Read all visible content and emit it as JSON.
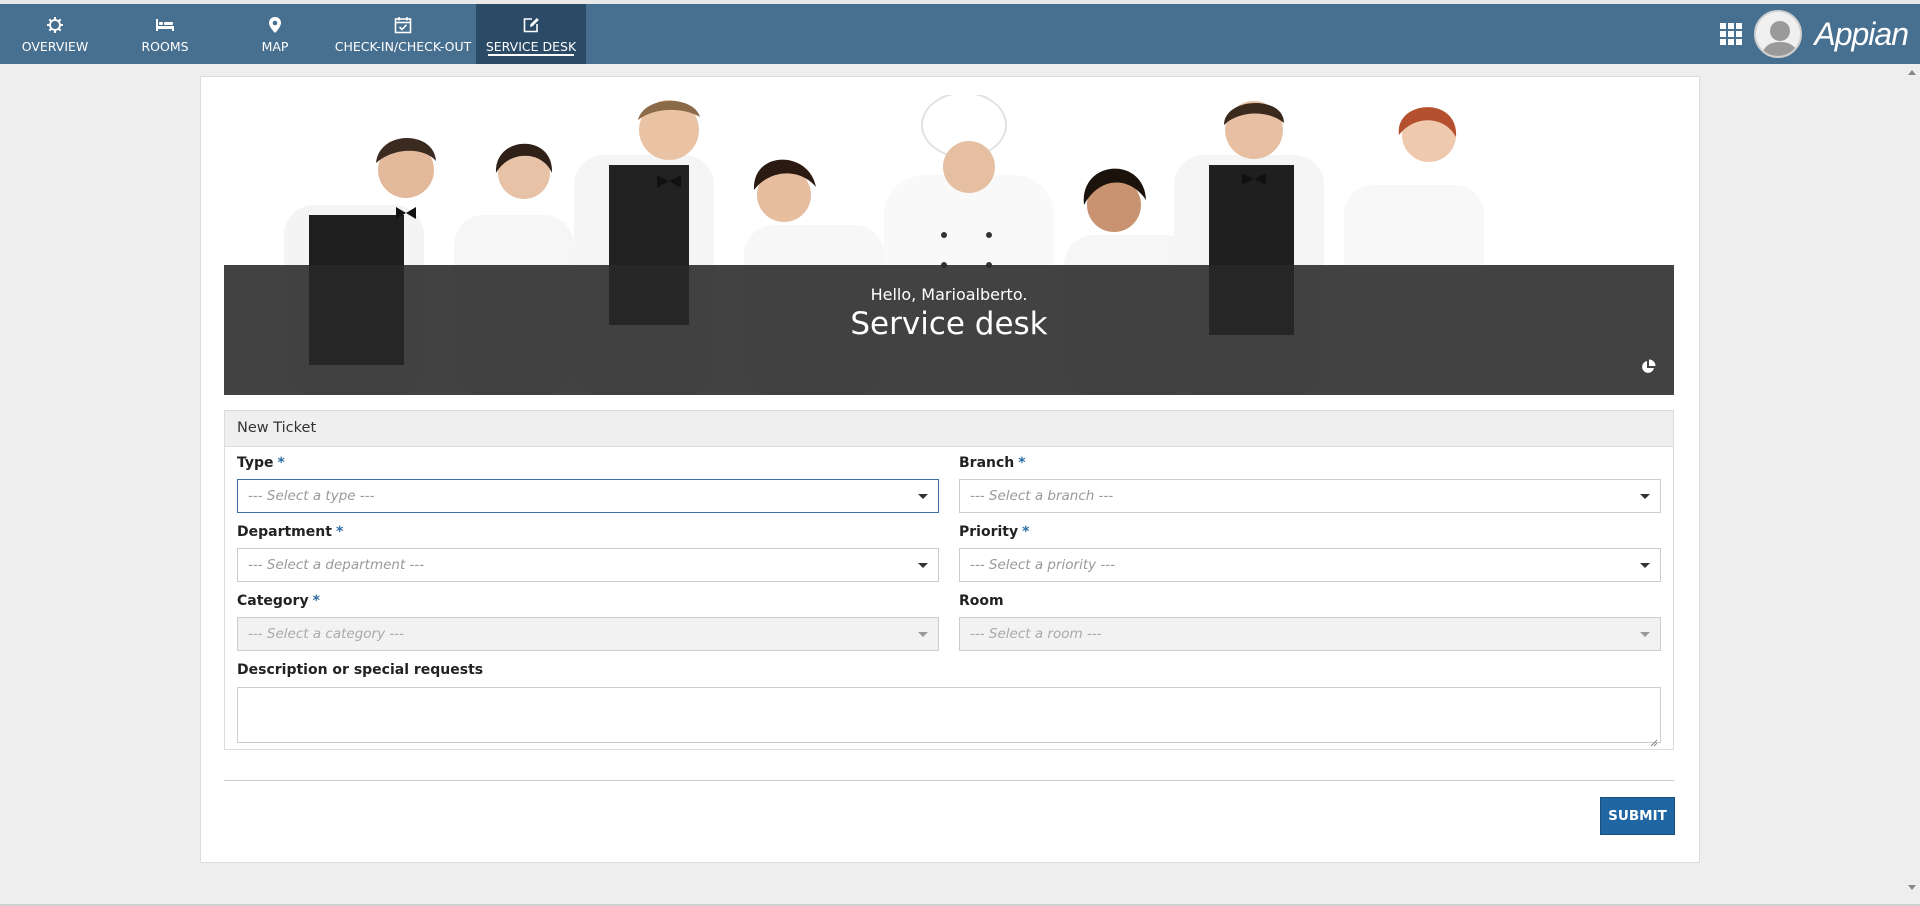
{
  "nav": {
    "tabs": [
      {
        "label": "OVERVIEW",
        "icon": "gear-icon"
      },
      {
        "label": "ROOMS",
        "icon": "bed-icon"
      },
      {
        "label": "MAP",
        "icon": "map-pin-icon"
      },
      {
        "label": "CHECK-IN/CHECK-OUT",
        "icon": "calendar-check-icon"
      },
      {
        "label": "SERVICE DESK",
        "icon": "edit-icon",
        "active": true
      }
    ],
    "brand": "Appian",
    "apps_icon": "grid-icon",
    "avatar_icon": "user-avatar"
  },
  "banner": {
    "greeting": "Hello, Marioalberto.",
    "title": "Service desk",
    "icon": "pie-chart-icon"
  },
  "form": {
    "section_title": "New Ticket",
    "type": {
      "label": "Type",
      "placeholder": "--- Select a type ---",
      "required": true
    },
    "branch": {
      "label": "Branch",
      "placeholder": "--- Select a branch ---",
      "required": true
    },
    "department": {
      "label": "Department",
      "placeholder": "--- Select a department ---",
      "required": true
    },
    "priority": {
      "label": "Priority",
      "placeholder": "--- Select a priority ---",
      "required": true
    },
    "category": {
      "label": "Category",
      "placeholder": "--- Select a category ---",
      "required": true
    },
    "room": {
      "label": "Room",
      "placeholder": "--- Select a room ---",
      "required": false
    },
    "description": {
      "label": "Description or special requests",
      "value": ""
    },
    "required_mark": "*",
    "submit_label": "SUBMIT"
  },
  "colors": {
    "navbar": "#476f8f",
    "active_tab": "#2a4a66",
    "submit": "#1f66a3"
  }
}
